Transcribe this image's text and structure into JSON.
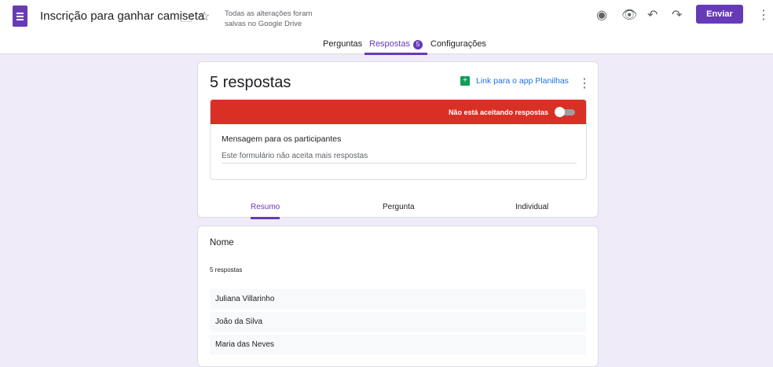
{
  "header": {
    "title": "Inscrição para ganhar camiseta",
    "saved_status": "Todas as alterações foram salvas no Google Drive",
    "send_label": "Enviar"
  },
  "tabs": [
    {
      "label": "Perguntas"
    },
    {
      "label": "Respostas",
      "badge": "5"
    },
    {
      "label": "Configurações"
    }
  ],
  "responses": {
    "count_title": "5 respostas",
    "sheets_link": "Link para o app Planilhas",
    "not_accepting": "Não está aceitando respostas",
    "accepting": false,
    "message_label": "Mensagem para os participantes",
    "message_value": "Este formulário não aceita mais respostas"
  },
  "subtabs": [
    {
      "label": "Resumo"
    },
    {
      "label": "Pergunta"
    },
    {
      "label": "Individual"
    }
  ],
  "question": {
    "title": "Nome",
    "count": "5 respostas",
    "answers": [
      "Juliana Villarinho",
      "João da Silva",
      "Maria das Neves"
    ]
  },
  "colors": {
    "accent": "#673ab7",
    "red": "#d93025"
  }
}
